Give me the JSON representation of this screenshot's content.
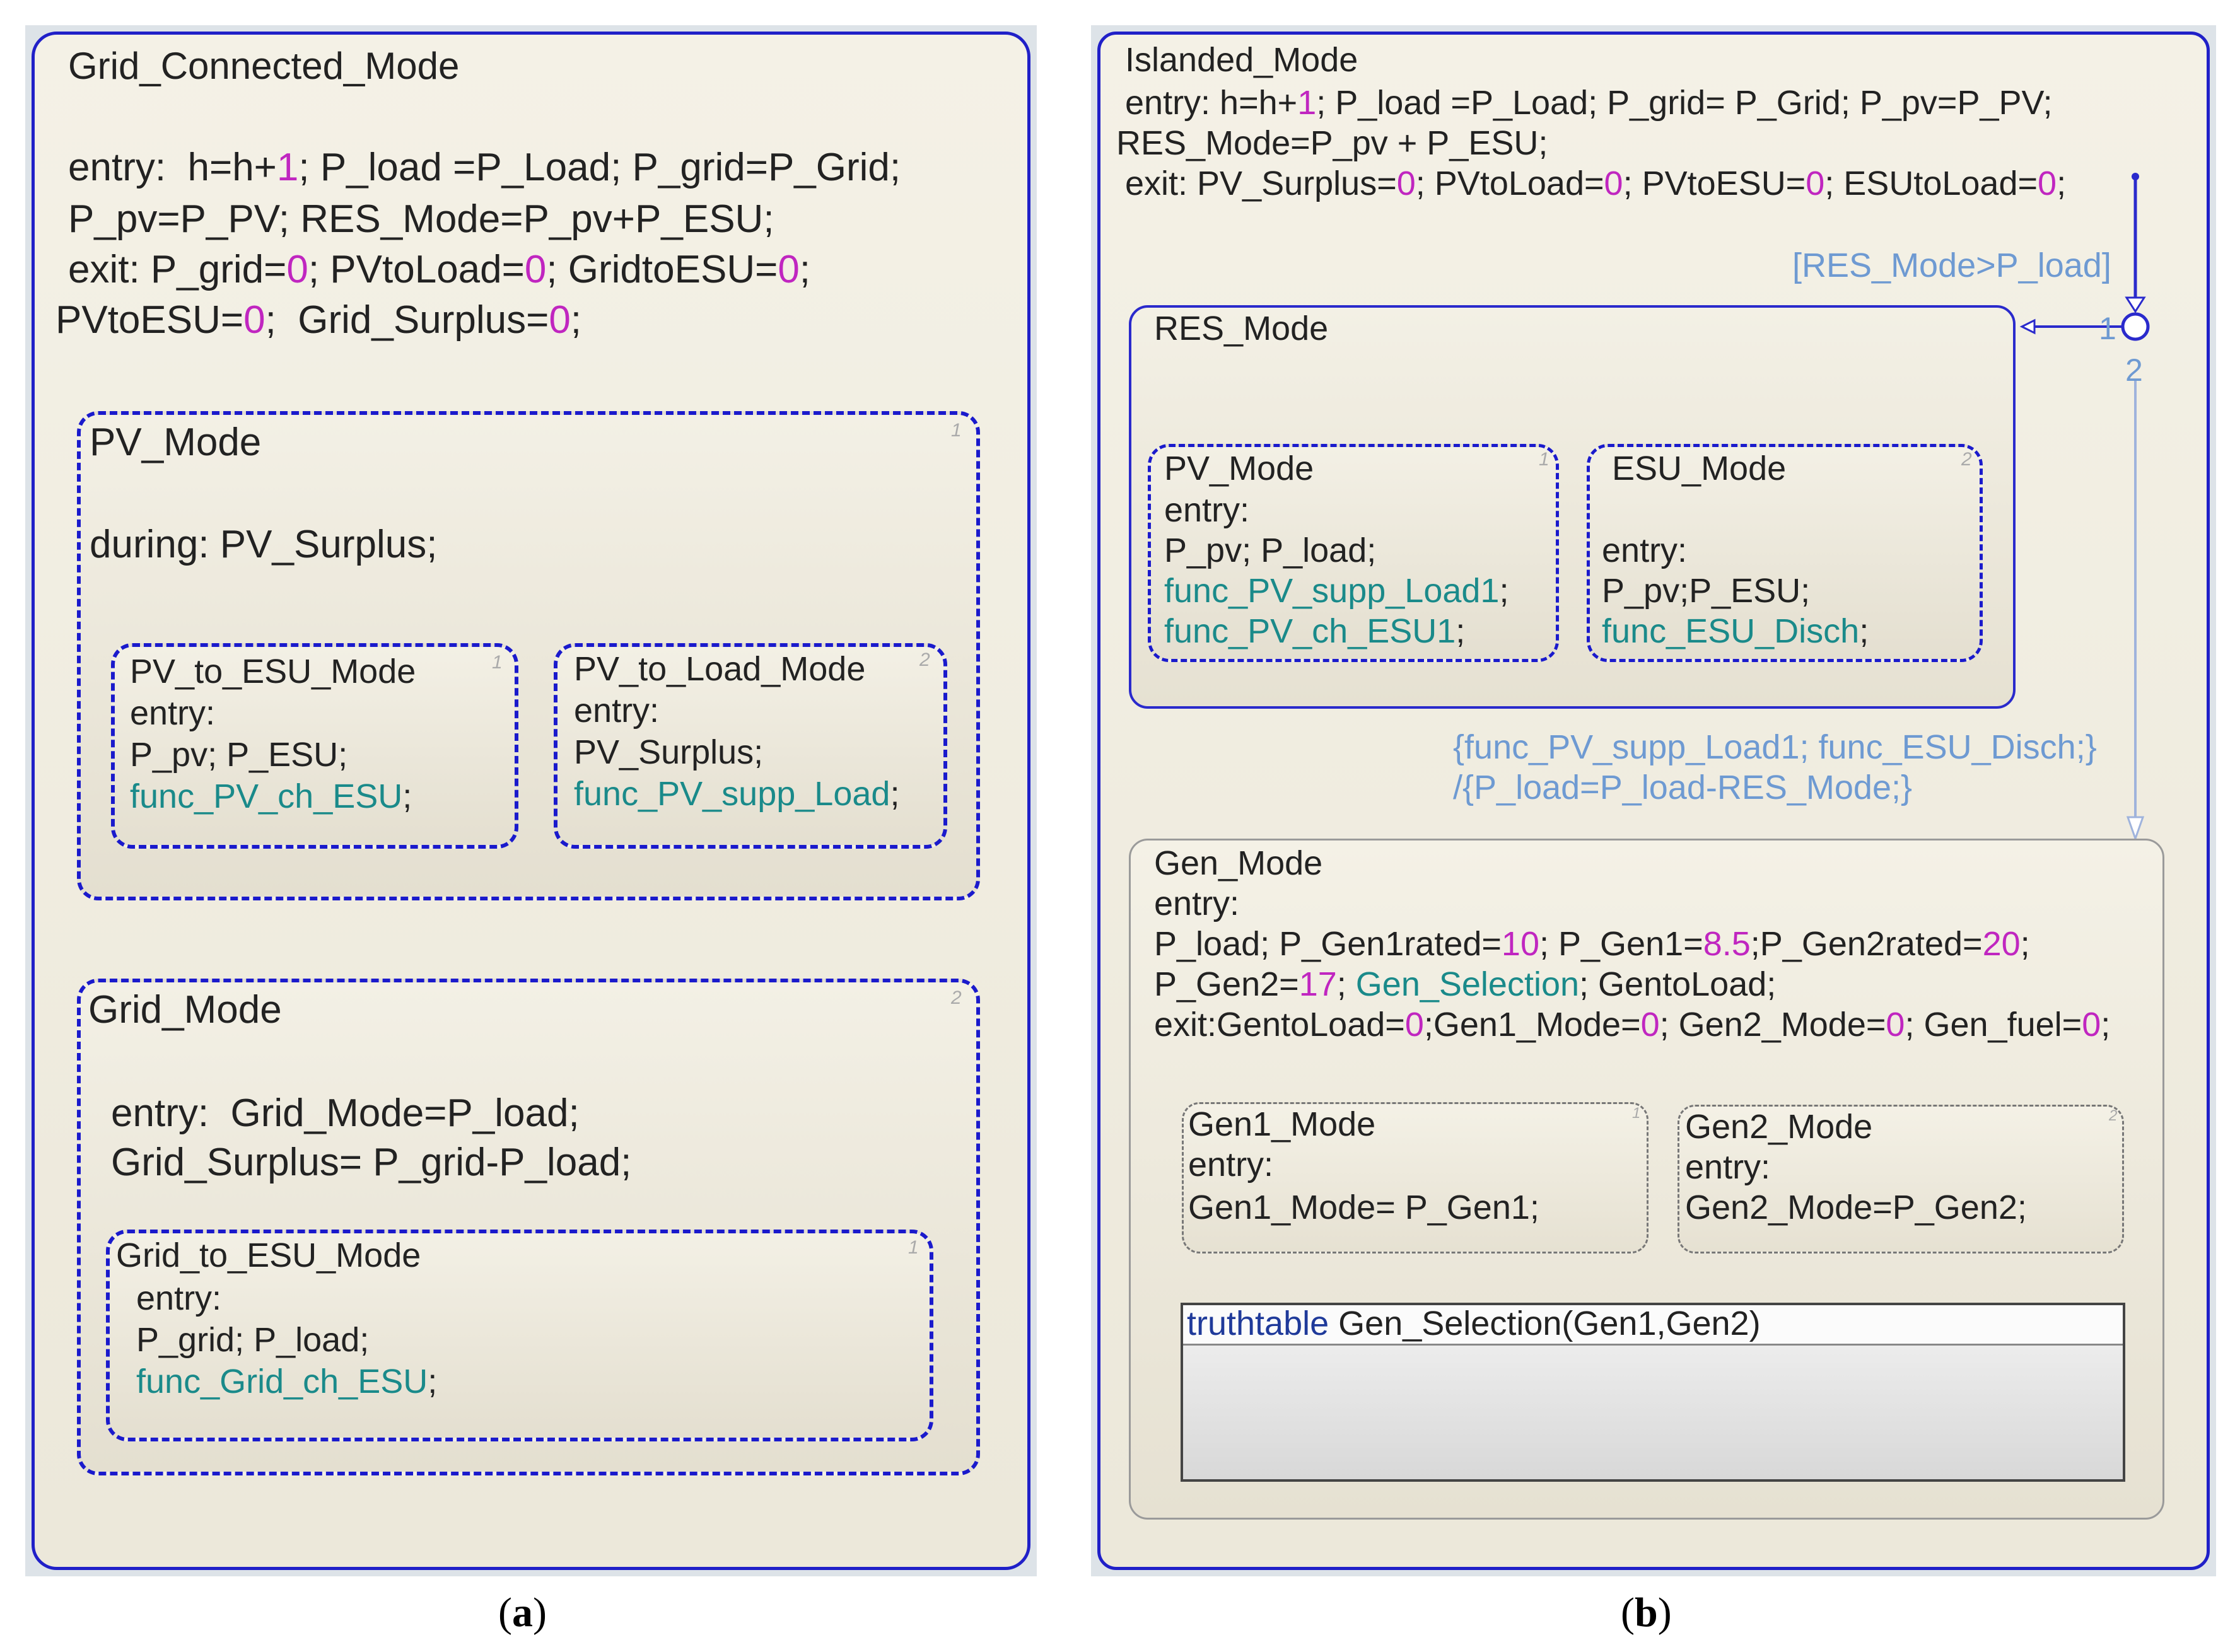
{
  "a": {
    "caption_open": "(",
    "caption_letter": "a",
    "caption_close": ")",
    "grid_connected": {
      "title": "Grid_Connected_Mode",
      "l1a": "entry:  h=h+",
      "l1b": "1",
      "l1c": "; P_load =P_Load; P_grid=P_Grid;",
      "l2": "P_pv=P_PV; RES_Mode=P_pv+P_ESU;",
      "l3a": "exit: P_grid=",
      "l3b": "0",
      "l3c": "; PVtoLoad=",
      "l3d": "0",
      "l3e": "; GridtoESU=",
      "l3f": "0",
      "l3g": ";",
      "l4a": "PVtoESU=",
      "l4b": "0",
      "l4c": ";  Grid_Surplus=",
      "l4d": "0",
      "l4e": ";"
    },
    "pv_mode": {
      "title": "PV_Mode",
      "order": "1",
      "during": "during: PV_Surplus;",
      "to_esu": {
        "title": "PV_to_ESU_Mode",
        "order": "1",
        "entry": "entry:",
        "vars": "P_pv; P_ESU;",
        "func": "func_PV_ch_ESU",
        "semi": ";"
      },
      "to_load": {
        "title": "PV_to_Load_Mode",
        "order": "2",
        "entry": "entry:",
        "vars": "PV_Surplus;",
        "func": "func_PV_supp_Load",
        "semi": ";"
      }
    },
    "grid_mode": {
      "title": "Grid_Mode",
      "order": "2",
      "entry1": "entry:  Grid_Mode=P_load;",
      "entry2": "Grid_Surplus= P_grid-P_load;",
      "to_esu": {
        "title": "Grid_to_ESU_Mode",
        "order": "1",
        "entry": "entry:",
        "vars": "P_grid; P_load;",
        "func": "func_Grid_ch_ESU",
        "semi": ";"
      }
    }
  },
  "b": {
    "caption_open": "(",
    "caption_letter": "b",
    "caption_close": ")",
    "islanded": {
      "title": "Islanded_Mode",
      "l1a": "entry: h=h+",
      "l1b": "1",
      "l1c": "; P_load =P_Load; P_grid= P_Grid; P_pv=P_PV;",
      "l2": "RES_Mode=P_pv + P_ESU;",
      "l3a": "exit: PV_Surplus=",
      "l3b": "0",
      "l3c": "; PVtoLoad=",
      "l3d": "0",
      "l3e": "; PVtoESU=",
      "l3f": "0",
      "l3g": "; ESUtoLoad=",
      "l3h": "0",
      "l3i": ";"
    },
    "condition": "[RES_Mode>P_load]",
    "junction_1": "1",
    "junction_2": "2",
    "res_mode": {
      "title": "RES_Mode",
      "pv": {
        "title": "PV_Mode",
        "order": "1",
        "entry": "entry:",
        "vars": "P_pv; P_load;",
        "func1": "func_PV_supp_Load1",
        "semi1": ";",
        "func2": "func_PV_ch_ESU1",
        "semi2": ";"
      },
      "esu": {
        "title": "ESU_Mode",
        "order": "2",
        "entry": "entry:",
        "vars": "P_pv;P_ESU;",
        "func": "func_ESU_Disch",
        "semi": ";"
      }
    },
    "transition_line1": "{func_PV_supp_Load1; func_ESU_Disch;}",
    "transition_line2": "/{P_load=P_load-RES_Mode;}",
    "gen_mode": {
      "title": "Gen_Mode",
      "entry": "entry:",
      "l1a": "P_load; P_Gen1rated=",
      "l1b": "10",
      "l1c": "; P_Gen1=",
      "l1d": "8.5",
      "l1e": ";P_Gen2rated=",
      "l1f": "20",
      "l1g": ";",
      "l2a": "P_Gen2=",
      "l2b": "17",
      "l2c": "; ",
      "l2d": "Gen_Selection",
      "l2e": "; GentoLoad;",
      "l3a": "exit:GentoLoad=",
      "l3b": "0",
      "l3c": ";Gen1_Mode=",
      "l3d": "0",
      "l3e": "; Gen2_Mode=",
      "l3f": "0",
      "l3g": "; Gen_fuel=",
      "l3h": "0",
      "l3i": ";",
      "gen1": {
        "title": "Gen1_Mode",
        "order": "1",
        "entry": "entry:",
        "body": "Gen1_Mode= P_Gen1;"
      },
      "gen2": {
        "title": "Gen2_Mode",
        "order": "2",
        "entry": "entry:",
        "body": "Gen2_Mode=P_Gen2;"
      },
      "truthtable_kw": "truthtable",
      "truthtable_sig": " Gen_Selection(Gen1,Gen2)"
    }
  },
  "colors": {
    "state_border": "#2020c8",
    "number": "#c026c0",
    "function": "#1a8a8a",
    "transition": "#6e9ad2"
  }
}
